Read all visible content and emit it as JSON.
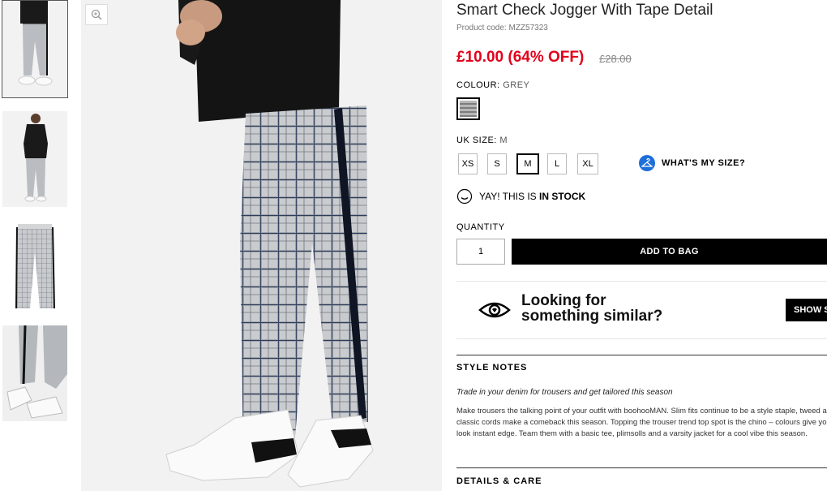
{
  "product": {
    "title": "Smart Check Jogger With Tape Detail",
    "code": "Product code: MZZ57323",
    "price": "£10.00 (64% OFF)",
    "old_price": "£28.00"
  },
  "colour": {
    "label": "COLOUR:",
    "value": "GREY"
  },
  "size": {
    "label": "UK SIZE:",
    "value": "M",
    "options": [
      "XS",
      "S",
      "M",
      "L",
      "XL"
    ],
    "selected": "M",
    "whats_my_size": "WHAT'S MY SIZE?"
  },
  "stock": {
    "prefix": "YAY! THIS IS",
    "status": "IN STOCK"
  },
  "quantity": {
    "label": "QUANTITY",
    "value": "1"
  },
  "add_to_bag": "ADD TO BAG",
  "similar": {
    "line1": "Looking for",
    "line2": "something similar?",
    "button": "SHOW S"
  },
  "style_notes": {
    "heading": "STYLE NOTES",
    "tagline": "Trade in your denim for trousers and get tailored this season",
    "body": "Make trousers the talking point of your outfit with boohooMAN. Slim fits continue to be a style staple, tweed and classic cords make a comeback this season. Topping the trouser trend top spot is the chino – colours give your look instant edge. Team them with a basic tee, plimsolls and a varsity jacket for a cool vibe this season."
  },
  "details": {
    "heading": "DETAILS & CARE"
  },
  "icons": {
    "zoom": "zoom-in-icon",
    "hanger": "hanger-icon",
    "smiley": "smiley-icon",
    "eye": "eye-icon"
  },
  "colors": {
    "sale": "#e3001b",
    "accent": "#1e6fd9",
    "button": "#000000"
  }
}
